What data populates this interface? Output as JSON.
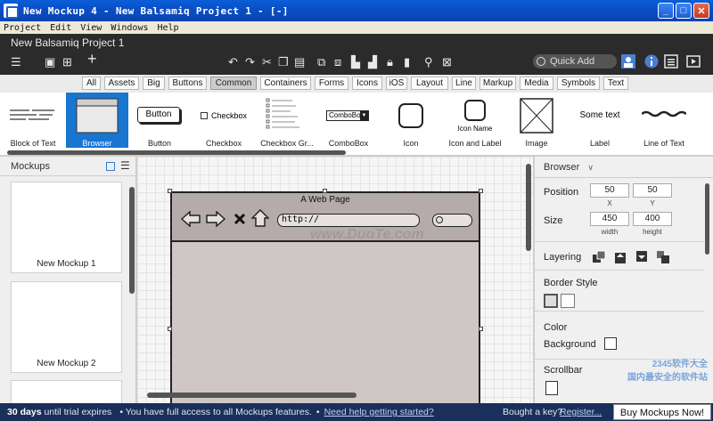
{
  "window": {
    "title": "New Mockup 4 - New Balsamiq Project 1 - [-]",
    "buttons": [
      "_",
      "□",
      "✕"
    ]
  },
  "menu": [
    "Project",
    "Edit",
    "View",
    "Windows",
    "Help"
  ],
  "header": {
    "project_name": "New Balsamiq Project 1",
    "quick_add_placeholder": "Quick Add"
  },
  "categories": [
    "All",
    "Assets",
    "Big",
    "Buttons",
    "Common",
    "Containers",
    "Forms",
    "Icons",
    "iOS",
    "Layout",
    "Line",
    "Markup",
    "Media",
    "Symbols",
    "Text"
  ],
  "selected_category": "Common",
  "library": [
    {
      "label": "Block of Text"
    },
    {
      "label": "Browser",
      "selected": true
    },
    {
      "label": "Button",
      "preview": "Button"
    },
    {
      "label": "Checkbox",
      "preview": "Checkbox"
    },
    {
      "label": "Checkbox Gr..."
    },
    {
      "label": "ComboBox",
      "preview": "ComboBox"
    },
    {
      "label": "Icon"
    },
    {
      "label": "Icon and Label",
      "preview": "Icon Name"
    },
    {
      "label": "Image"
    },
    {
      "label": "Label",
      "preview": "Some text"
    },
    {
      "label": "Line of Text"
    }
  ],
  "mockups_panel": {
    "title": "Mockups",
    "items": [
      "New Mockup 1",
      "New Mockup 2"
    ]
  },
  "canvas": {
    "page_title": "A Web Page",
    "url": "http://",
    "watermark": "www.DuoTe.com"
  },
  "inspector": {
    "title": "Browser",
    "position_label": "Position",
    "x": "50",
    "y": "50",
    "x_label": "X",
    "y_label": "Y",
    "size_label": "Size",
    "width": "450",
    "height": "400",
    "width_label": "width",
    "height_label": "height",
    "layering_label": "Layering",
    "border_style_label": "Border Style",
    "color_label": "Color",
    "background_label": "Background",
    "scrollbar_label": "Scrollbar"
  },
  "status": {
    "days": "30 days",
    "until": " until trial expires",
    "access": "• You have full access to all Mockups features.",
    "bullet": "•",
    "help_link": "Need help getting started?",
    "bought": "Bought a key?",
    "register_link": "Register...",
    "buy": "Buy Mockups Now!"
  },
  "overlay_watermark": {
    "line1": "2345软件大全",
    "line2": "国内最安全的软件站"
  }
}
